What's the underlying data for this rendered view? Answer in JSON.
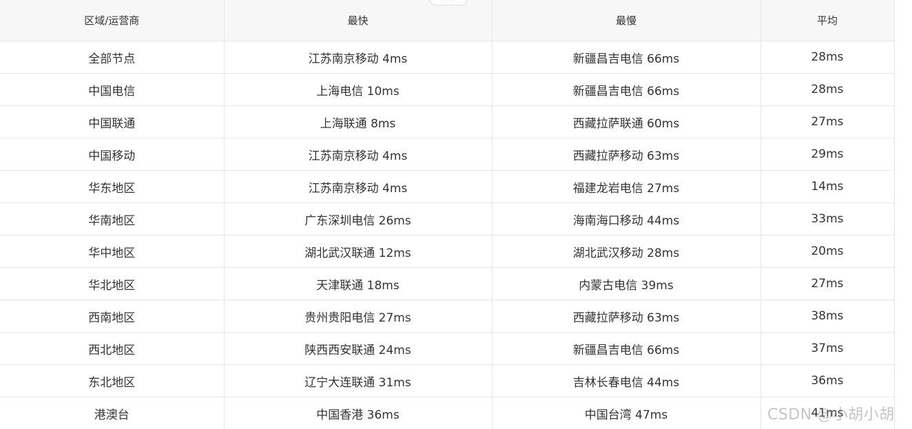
{
  "table": {
    "headers": [
      "区域/运营商",
      "最快",
      "最慢",
      "平均"
    ],
    "rows": [
      [
        "全部节点",
        "江苏南京移动 4ms",
        "新疆昌吉电信 66ms",
        "28ms"
      ],
      [
        "中国电信",
        "上海电信 10ms",
        "新疆昌吉电信 66ms",
        "28ms"
      ],
      [
        "中国联通",
        "上海联通 8ms",
        "西藏拉萨联通 60ms",
        "27ms"
      ],
      [
        "中国移动",
        "江苏南京移动 4ms",
        "西藏拉萨移动 63ms",
        "29ms"
      ],
      [
        "华东地区",
        "江苏南京移动 4ms",
        "福建龙岩电信 27ms",
        "14ms"
      ],
      [
        "华南地区",
        "广东深圳电信 26ms",
        "海南海口移动 44ms",
        "33ms"
      ],
      [
        "华中地区",
        "湖北武汉联通 12ms",
        "湖北武汉移动 28ms",
        "20ms"
      ],
      [
        "华北地区",
        "天津联通 18ms",
        "内蒙古电信 39ms",
        "27ms"
      ],
      [
        "西南地区",
        "贵州贵阳电信 27ms",
        "西藏拉萨移动 63ms",
        "38ms"
      ],
      [
        "西北地区",
        "陕西西安联通 24ms",
        "新疆昌吉电信 66ms",
        "37ms"
      ],
      [
        "东北地区",
        "辽宁大连联通 31ms",
        "吉林长春电信 44ms",
        "36ms"
      ],
      [
        "港澳台",
        "中国香港 36ms",
        "中国台湾 47ms",
        "41ms"
      ]
    ]
  },
  "top_tab": {
    "icon": "chevron-up-icon"
  },
  "watermark": "CSDN @小胡小胡",
  "colors": {
    "header_bg": "#f7f7f7",
    "border": "#e6e6e6",
    "text": "#333333"
  }
}
